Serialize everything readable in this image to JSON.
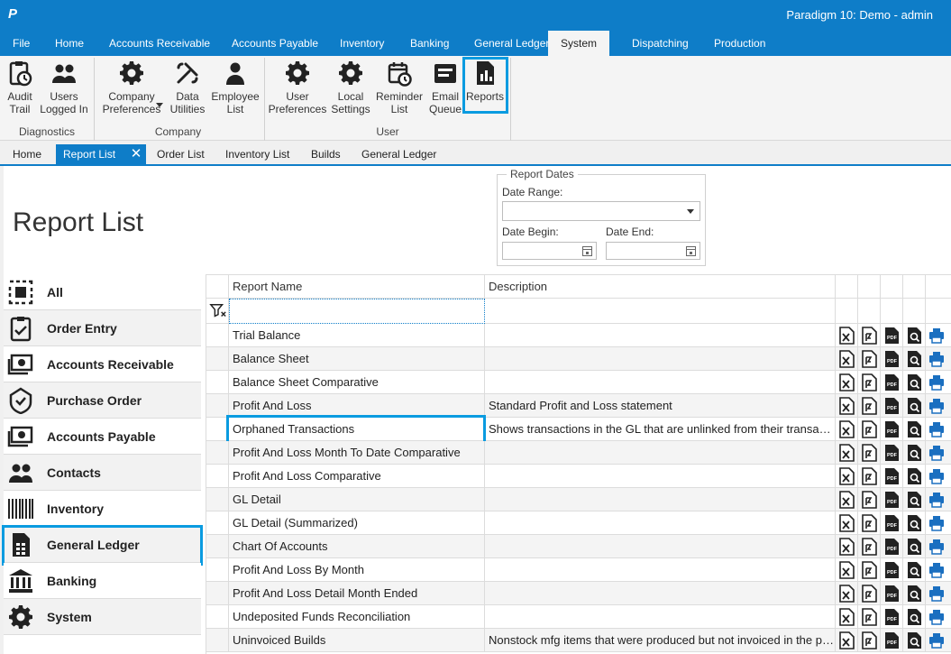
{
  "app": {
    "title": "Paradigm 10: Demo - admin",
    "logo": "P"
  },
  "menu": [
    "File",
    "Home",
    "Accounts Receivable",
    "Accounts Payable",
    "Inventory",
    "Banking",
    "General Ledger",
    "System",
    "Dispatching",
    "Production"
  ],
  "menu_active": "System",
  "ribbon": {
    "groups": [
      {
        "label": "Diagnostics",
        "buttons": [
          {
            "label": "Audit\nTrail",
            "icon": "clipboard-clock-icon"
          },
          {
            "label": "Users\nLogged In",
            "icon": "users-icon"
          }
        ]
      },
      {
        "label": "Company",
        "buttons": [
          {
            "label": "Company\nPreferences",
            "icon": "gear-icon"
          },
          {
            "label": "Data\nUtilities",
            "icon": "tools-icon"
          },
          {
            "label": "Employee\nList",
            "icon": "person-icon"
          }
        ]
      },
      {
        "label": "User",
        "buttons": [
          {
            "label": "User\nPreferences",
            "icon": "gear-icon"
          },
          {
            "label": "Local\nSettings",
            "icon": "gear-icon"
          },
          {
            "label": "Reminder\nList",
            "icon": "calendar-clock-icon"
          },
          {
            "label": "Email\nQueue",
            "icon": "email-queue-icon"
          },
          {
            "label": "Reports",
            "icon": "report-chart-icon"
          }
        ]
      }
    ]
  },
  "tabs": [
    "Home",
    "Report List",
    "Order List",
    "Inventory List",
    "Builds",
    "General Ledger"
  ],
  "tab_active": "Report List",
  "page_title": "Report List",
  "report_dates": {
    "legend": "Report Dates",
    "date_range_label": "Date Range:",
    "date_range_value": "",
    "date_begin_label": "Date Begin:",
    "date_begin_value": "",
    "date_end_label": "Date End:",
    "date_end_value": ""
  },
  "sidebar": [
    {
      "label": "All",
      "icon": "select-all-icon"
    },
    {
      "label": "Order Entry",
      "icon": "clipboard-check-icon"
    },
    {
      "label": "Accounts Receivable",
      "icon": "money-in-icon"
    },
    {
      "label": "Purchase Order",
      "icon": "shield-check-icon"
    },
    {
      "label": "Accounts Payable",
      "icon": "money-out-icon"
    },
    {
      "label": "Contacts",
      "icon": "contacts-icon"
    },
    {
      "label": "Inventory",
      "icon": "barcode-icon"
    },
    {
      "label": "General Ledger",
      "icon": "ledger-document-icon"
    },
    {
      "label": "Banking",
      "icon": "bank-icon"
    },
    {
      "label": "System",
      "icon": "gear-icon"
    }
  ],
  "sidebar_selected": "General Ledger",
  "grid": {
    "columns": [
      "Report Name",
      "Description"
    ],
    "filter_value": "",
    "rows": [
      {
        "name": "Trial Balance",
        "desc": ""
      },
      {
        "name": "Balance Sheet",
        "desc": ""
      },
      {
        "name": "Balance Sheet Comparative",
        "desc": ""
      },
      {
        "name": "Profit And Loss",
        "desc": "Standard Profit and Loss statement"
      },
      {
        "name": "Orphaned Transactions",
        "desc": "Shows transactions in the GL that are unlinked from their transactions"
      },
      {
        "name": "Profit And Loss Month To Date Comparative",
        "desc": ""
      },
      {
        "name": "Profit And Loss Comparative",
        "desc": ""
      },
      {
        "name": "GL Detail",
        "desc": ""
      },
      {
        "name": "GL Detail (Summarized)",
        "desc": ""
      },
      {
        "name": "Chart Of Accounts",
        "desc": ""
      },
      {
        "name": "Profit And Loss By Month",
        "desc": ""
      },
      {
        "name": "Profit And Loss Detail Month Ended",
        "desc": ""
      },
      {
        "name": "Undeposited Funds Reconciliation",
        "desc": ""
      },
      {
        "name": "Uninvoiced Builds",
        "desc": "Nonstock mfg items that were produced but not invoiced in the period"
      }
    ],
    "highlighted_row": "Orphaned Transactions",
    "row_actions": [
      "excel-export-icon",
      "word-export-icon",
      "pdf-export-icon",
      "preview-icon",
      "print-icon"
    ],
    "pdf_text": "PDF"
  },
  "colors": {
    "primary": "#0e7dc8",
    "highlight": "#0a9be0"
  }
}
